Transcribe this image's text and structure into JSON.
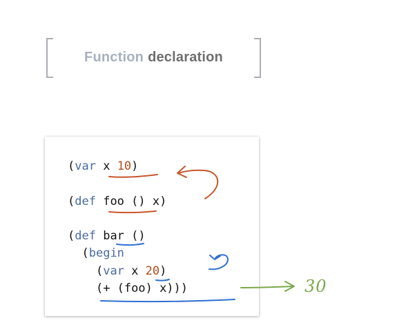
{
  "title": {
    "part1": "Function",
    "part2": "declaration"
  },
  "code": {
    "line1": {
      "open": "(",
      "kw": "var",
      "name": " x ",
      "num": "10",
      "close": ")"
    },
    "line2": {
      "open": "(",
      "kw": "def",
      "rest": " foo () x)"
    },
    "line3": {
      "open": "(",
      "kw": "def",
      "rest": " bar ()"
    },
    "line4": {
      "indent": "  ",
      "open": "(",
      "kw": "begin"
    },
    "line5": {
      "indent": "    ",
      "open": "(",
      "kw": "var",
      "name": " x ",
      "num": "20",
      "close": ")"
    },
    "line6": {
      "indent": "    ",
      "text": "(+ (foo) x)))"
    }
  },
  "annotation": {
    "result": "30",
    "colors": {
      "red": "#c8542a",
      "blue": "#2f6fd0",
      "green": "#7aa84a"
    }
  }
}
